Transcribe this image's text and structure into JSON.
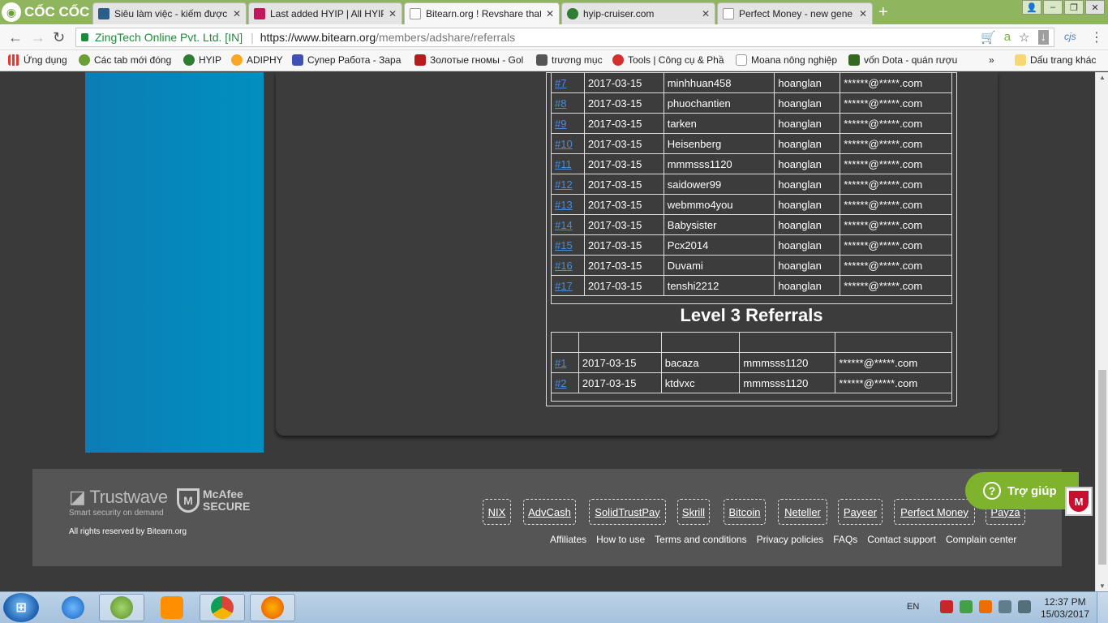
{
  "browser": {
    "logo_text": "CỐC CỐC",
    "tabs": [
      {
        "title": "Siêu làm việc - kiếm được",
        "color": "#2b5d8a"
      },
      {
        "title": "Last added HYIP | All HYIP",
        "color": "#c2185b"
      },
      {
        "title": "Bitearn.org ! Revshare that",
        "color": "#888888"
      },
      {
        "title": "hyip-cruiser.com",
        "color": "#2e7d32"
      },
      {
        "title": "Perfect Money - new gene",
        "color": "#888888"
      }
    ],
    "new_tab": "+",
    "secure_label": "ZingTech Online Pvt. Ltd. [IN]",
    "url_host": "https://www.bitearn.org",
    "url_path": "/members/adshare/referrals",
    "extension_label": "cjs",
    "bookmarks": [
      {
        "label": "Ứng dụng",
        "color": "#e53935"
      },
      {
        "label": "Các tab mới đóng",
        "color": "#6a9f36"
      },
      {
        "label": "HYIP",
        "color": "#2e7d32"
      },
      {
        "label": "ADIPHY",
        "color": "#f9a825"
      },
      {
        "label": "Супер Работа - Зарабо",
        "color": "#3f51b5"
      },
      {
        "label": "Золотые гномы - Gol",
        "color": "#b71c1c"
      },
      {
        "label": "trương mục",
        "color": "#555555"
      },
      {
        "label": "Tools | Công cụ & Phầ",
        "color": "#d32f2f"
      },
      {
        "label": "Moana nông nghiệp",
        "color": "#9e9e9e"
      },
      {
        "label": "vốn Dota - quán rượu",
        "color": "#33691e"
      }
    ],
    "bookmarks_more": "»",
    "other_bookmarks": "Dấu trang khác"
  },
  "level2": {
    "rows": [
      {
        "num": "#7",
        "date": "2017-03-15",
        "user": "minhhuan458",
        "upline": "hoanglan",
        "email": "******@*****.com"
      },
      {
        "num": "#8",
        "date": "2017-03-15",
        "user": "phuochantien",
        "upline": "hoanglan",
        "email": "******@*****.com"
      },
      {
        "num": "#9",
        "date": "2017-03-15",
        "user": "tarken",
        "upline": "hoanglan",
        "email": "******@*****.com"
      },
      {
        "num": "#10",
        "date": "2017-03-15",
        "user": "Heisenberg",
        "upline": "hoanglan",
        "email": "******@*****.com"
      },
      {
        "num": "#11",
        "date": "2017-03-15",
        "user": "mmmsss1120",
        "upline": "hoanglan",
        "email": "******@*****.com"
      },
      {
        "num": "#12",
        "date": "2017-03-15",
        "user": "saidower99",
        "upline": "hoanglan",
        "email": "******@*****.com"
      },
      {
        "num": "#13",
        "date": "2017-03-15",
        "user": "webmmo4you",
        "upline": "hoanglan",
        "email": "******@*****.com"
      },
      {
        "num": "#14",
        "date": "2017-03-15",
        "user": "Babysister",
        "upline": "hoanglan",
        "email": "******@*****.com"
      },
      {
        "num": "#15",
        "date": "2017-03-15",
        "user": "Pcx2014",
        "upline": "hoanglan",
        "email": "******@*****.com"
      },
      {
        "num": "#16",
        "date": "2017-03-15",
        "user": "Duvami",
        "upline": "hoanglan",
        "email": "******@*****.com"
      },
      {
        "num": "#17",
        "date": "2017-03-15",
        "user": "tenshi2212",
        "upline": "hoanglan",
        "email": "******@*****.com"
      }
    ]
  },
  "level3": {
    "title": "Level 3 Referrals",
    "rows": [
      {
        "num": "#1",
        "date": "2017-03-15",
        "user": "bacaza",
        "upline": "mmmsss1120",
        "email": "******@*****.com"
      },
      {
        "num": "#2",
        "date": "2017-03-15",
        "user": "ktdvxc",
        "upline": "mmmsss1120",
        "email": "******@*****.com"
      }
    ]
  },
  "footer": {
    "trustwave": "Trustwave",
    "trustwave_tag": "Smart security on demand",
    "mcafee_line1": "McAfee",
    "mcafee_line2": "SECURE",
    "rights": "All rights reserved by Bitearn.org",
    "payments": [
      "NIX",
      "AdvCash",
      "SolidTrustPay",
      "Skrill",
      "Bitcoin",
      "Neteller",
      "Payeer",
      "Perfect Money",
      "Payza"
    ],
    "links": [
      "Affiliates",
      "How to use",
      "Terms and conditions",
      "Privacy policies",
      "FAQs",
      "Contact support",
      "Complain center"
    ]
  },
  "help_label": "Trợ giúp",
  "taskbar": {
    "lang": "EN",
    "time": "12:37 PM",
    "date": "15/03/2017"
  }
}
